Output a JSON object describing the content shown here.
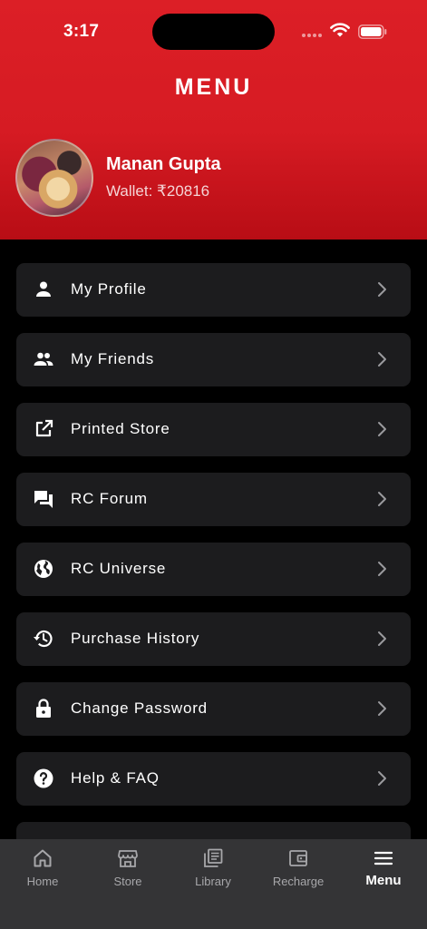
{
  "status_bar": {
    "time": "3:17"
  },
  "header": {
    "title": "MENU"
  },
  "profile": {
    "name": "Manan Gupta",
    "wallet": "Wallet: ₹20816"
  },
  "menu": {
    "items": [
      {
        "label": "My Profile",
        "icon": "person-icon"
      },
      {
        "label": "My Friends",
        "icon": "people-icon"
      },
      {
        "label": "Printed Store",
        "icon": "external-link-icon"
      },
      {
        "label": "RC Forum",
        "icon": "forum-icon"
      },
      {
        "label": "RC Universe",
        "icon": "globe-icon"
      },
      {
        "label": "Purchase History",
        "icon": "history-icon"
      },
      {
        "label": "Change Password",
        "icon": "lock-icon"
      },
      {
        "label": "Help & FAQ",
        "icon": "help-icon"
      }
    ]
  },
  "tabbar": {
    "tabs": [
      {
        "label": "Home",
        "icon": "home-icon"
      },
      {
        "label": "Store",
        "icon": "store-icon"
      },
      {
        "label": "Library",
        "icon": "library-icon"
      },
      {
        "label": "Recharge",
        "icon": "wallet-icon"
      },
      {
        "label": "Menu",
        "icon": "menu-icon",
        "active": true
      }
    ]
  },
  "colors": {
    "header_red": "#d61b23",
    "card_bg": "#1c1c1e",
    "tabbar_bg": "#343436",
    "inactive_tab": "#a7a7aa"
  }
}
